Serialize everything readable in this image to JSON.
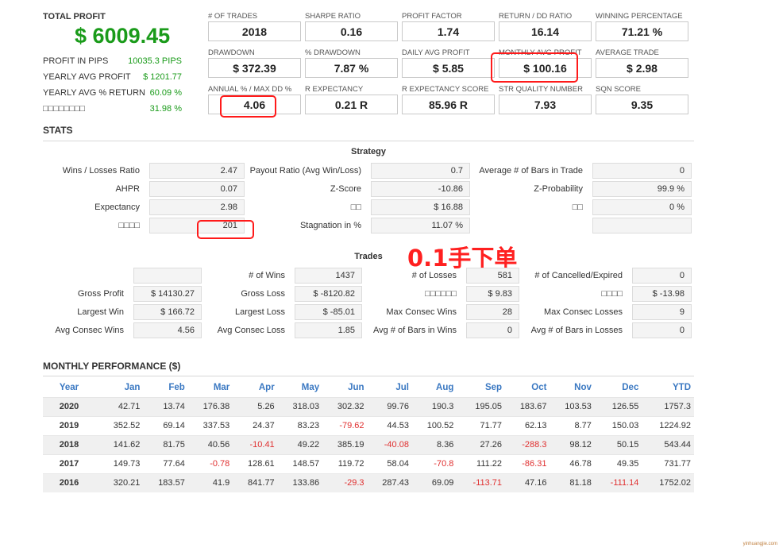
{
  "summary": {
    "total_profit_label": "TOTAL PROFIT",
    "total_profit_value": "$ 6009.45",
    "rows": [
      {
        "label": "PROFIT IN PIPS",
        "value": "10035.3 PIPS"
      },
      {
        "label": "YEARLY AVG PROFIT",
        "value": "$ 1201.77"
      },
      {
        "label": "YEARLY AVG % RETURN",
        "value": "60.09 %"
      },
      {
        "label": "□□□□□□□□",
        "value": "31.98 %"
      }
    ]
  },
  "boxes": [
    {
      "label": "# OF TRADES",
      "value": "2018"
    },
    {
      "label": "SHARPE RATIO",
      "value": "0.16"
    },
    {
      "label": "PROFIT FACTOR",
      "value": "1.74"
    },
    {
      "label": "RETURN / DD RATIO",
      "value": "16.14"
    },
    {
      "label": "WINNING PERCENTAGE",
      "value": "71.21 %"
    },
    {
      "label": "DRAWDOWN",
      "value": "$ 372.39"
    },
    {
      "label": "% DRAWDOWN",
      "value": "7.87 %"
    },
    {
      "label": "DAILY AVG PROFIT",
      "value": "$ 5.85"
    },
    {
      "label": "MONTHLY AVG PROFIT",
      "value": "$ 100.16"
    },
    {
      "label": "AVERAGE TRADE",
      "value": "$ 2.98"
    },
    {
      "label": "ANNUAL % / MAX DD %",
      "value": "4.06"
    },
    {
      "label": "R EXPECTANCY",
      "value": "0.21 R"
    },
    {
      "label": "R EXPECTANCY SCORE",
      "value": "85.96 R"
    },
    {
      "label": "STR QUALITY NUMBER",
      "value": "7.93"
    },
    {
      "label": "SQN SCORE",
      "value": "9.35"
    }
  ],
  "stats": {
    "title": "STATS",
    "strategy_title": "Strategy",
    "strategy": [
      {
        "label": "Wins / Losses Ratio",
        "value": "2.47"
      },
      {
        "label": "Payout Ratio (Avg Win/Loss)",
        "value": "0.7"
      },
      {
        "label": "Average # of Bars in Trade",
        "value": "0"
      },
      {
        "label": "AHPR",
        "value": "0.07"
      },
      {
        "label": "Z-Score",
        "value": "-10.86"
      },
      {
        "label": "Z-Probability",
        "value": "99.9 %"
      },
      {
        "label": "Expectancy",
        "value": "2.98"
      },
      {
        "label": "□□",
        "value": "$ 16.88"
      },
      {
        "label": "□□",
        "value": "0 %"
      },
      {
        "label": "□□□□",
        "value": "201"
      },
      {
        "label": "Stagnation in %",
        "value": "11.07 %"
      },
      {
        "label": "",
        "value": ""
      }
    ],
    "trades_title": "Trades",
    "annotation": "0.1手下单",
    "trades": [
      {
        "label": "",
        "value": ""
      },
      {
        "label": "# of Wins",
        "value": "1437"
      },
      {
        "label": "# of Losses",
        "value": "581"
      },
      {
        "label": "# of Cancelled/Expired",
        "value": "0"
      },
      {
        "label": "Gross Profit",
        "value": "$ 14130.27"
      },
      {
        "label": "Gross Loss",
        "value": "$ -8120.82"
      },
      {
        "label": "□□□□□□",
        "value": "$ 9.83"
      },
      {
        "label": "□□□□",
        "value": "$ -13.98"
      },
      {
        "label": "Largest Win",
        "value": "$ 166.72"
      },
      {
        "label": "Largest Loss",
        "value": "$ -85.01"
      },
      {
        "label": "Max Consec Wins",
        "value": "28"
      },
      {
        "label": "Max Consec Losses",
        "value": "9"
      },
      {
        "label": "Avg Consec Wins",
        "value": "4.56"
      },
      {
        "label": "Avg Consec Loss",
        "value": "1.85"
      },
      {
        "label": "Avg # of Bars in Wins",
        "value": "0"
      },
      {
        "label": "Avg # of Bars in Losses",
        "value": "0"
      }
    ]
  },
  "monthly": {
    "title": "MONTHLY PERFORMANCE ($)",
    "headers": [
      "Year",
      "Jan",
      "Feb",
      "Mar",
      "Apr",
      "May",
      "Jun",
      "Jul",
      "Aug",
      "Sep",
      "Oct",
      "Nov",
      "Dec",
      "YTD"
    ],
    "rows": [
      [
        "2020",
        "42.71",
        "13.74",
        "176.38",
        "5.26",
        "318.03",
        "302.32",
        "99.76",
        "190.3",
        "195.05",
        "183.67",
        "103.53",
        "126.55",
        "1757.3"
      ],
      [
        "2019",
        "352.52",
        "69.14",
        "337.53",
        "24.37",
        "83.23",
        "-79.62",
        "44.53",
        "100.52",
        "71.77",
        "62.13",
        "8.77",
        "150.03",
        "1224.92"
      ],
      [
        "2018",
        "141.62",
        "81.75",
        "40.56",
        "-10.41",
        "49.22",
        "385.19",
        "-40.08",
        "8.36",
        "27.26",
        "-288.3",
        "98.12",
        "50.15",
        "543.44"
      ],
      [
        "2017",
        "149.73",
        "77.64",
        "-0.78",
        "128.61",
        "148.57",
        "119.72",
        "58.04",
        "-70.8",
        "111.22",
        "-86.31",
        "46.78",
        "49.35",
        "731.77"
      ],
      [
        "2016",
        "320.21",
        "183.57",
        "41.9",
        "841.77",
        "133.86",
        "-29.3",
        "287.43",
        "69.09",
        "-113.71",
        "47.16",
        "81.18",
        "-111.14",
        "1752.02"
      ]
    ]
  },
  "colors": {
    "positive": "#1a9b1a",
    "negative": "#e03030",
    "header_blue": "#3a78c2",
    "highlight": "#ff1a1a"
  },
  "watermark": "yinhuangjie.com"
}
